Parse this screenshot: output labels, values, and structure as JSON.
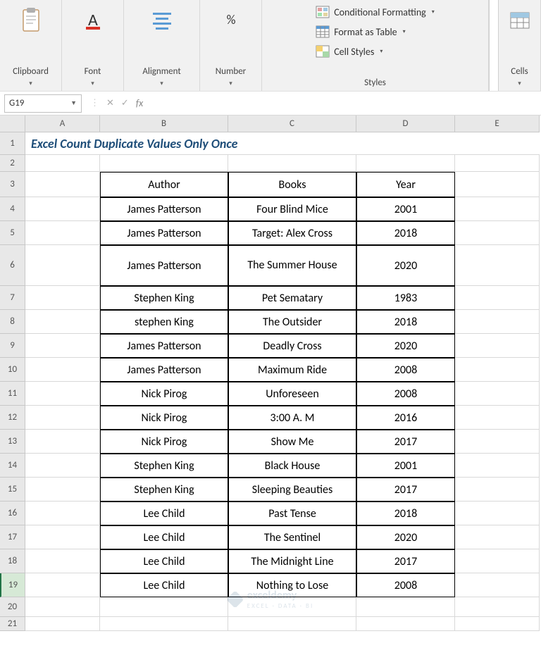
{
  "ribbon": {
    "clipboard": "Clipboard",
    "font": "Font",
    "alignment": "Alignment",
    "number": "Number",
    "cells": "Cells",
    "styles_label": "Styles",
    "cond_formatting": "Conditional Formatting",
    "format_table": "Format as Table",
    "cell_styles": "Cell Styles"
  },
  "namebox": "G19",
  "formula": "",
  "columns": [
    "A",
    "B",
    "C",
    "D",
    "E"
  ],
  "title": "Excel Count Duplicate Values Only Once",
  "table": {
    "headers": {
      "author": "Author",
      "books": "Books",
      "year": "Year"
    },
    "rows": [
      {
        "author": "James Patterson",
        "book": "Four Blind Mice",
        "year": "2001"
      },
      {
        "author": "James Patterson",
        "book": "Target: Alex Cross",
        "year": "2018"
      },
      {
        "author": "James Patterson",
        "book": "The Summer House",
        "year": "2020"
      },
      {
        "author": "Stephen King",
        "book": "Pet Sematary",
        "year": "1983"
      },
      {
        "author": "stephen King",
        "book": "The Outsider",
        "year": "2018"
      },
      {
        "author": "James Patterson",
        "book": "Deadly Cross",
        "year": "2020"
      },
      {
        "author": "James Patterson",
        "book": "Maximum Ride",
        "year": "2008"
      },
      {
        "author": "Nick Pirog",
        "book": "Unforeseen",
        "year": "2008"
      },
      {
        "author": "Nick Pirog",
        "book": "3:00 A. M",
        "year": "2016"
      },
      {
        "author": "Nick Pirog",
        "book": "Show Me",
        "year": "2017"
      },
      {
        "author": "Stephen King",
        "book": "Black House",
        "year": "2001"
      },
      {
        "author": "Stephen King",
        "book": "Sleeping Beauties",
        "year": "2017"
      },
      {
        "author": "Lee Child",
        "book": "Past Tense",
        "year": "2018"
      },
      {
        "author": "Lee Child",
        "book": "The Sentinel",
        "year": "2020"
      },
      {
        "author": "Lee Child",
        "book": "The Midnight Line",
        "year": "2017"
      },
      {
        "author": "Lee Child",
        "book": "Nothing to Lose",
        "year": "2008"
      }
    ]
  },
  "watermark": {
    "brand": "exceldemy",
    "sub": "EXCEL · DATA · BI"
  }
}
